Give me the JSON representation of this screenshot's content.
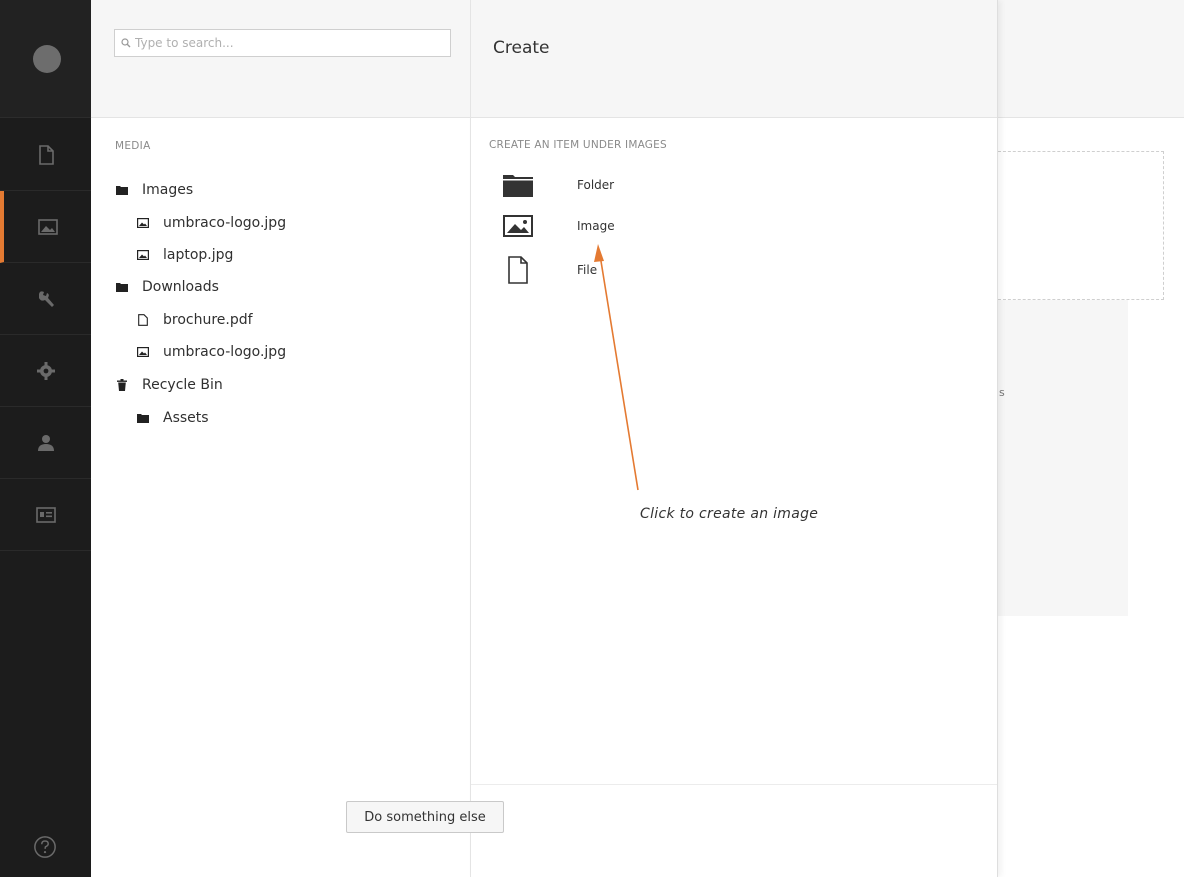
{
  "search": {
    "placeholder": "Type to search..."
  },
  "tree": {
    "section_title": "MEDIA",
    "nodes": [
      {
        "label": "Images",
        "icon": "folder-icon"
      },
      {
        "label": "umbraco-logo.jpg",
        "icon": "image-icon"
      },
      {
        "label": "laptop.jpg",
        "icon": "image-icon"
      },
      {
        "label": "Downloads",
        "icon": "folder-icon"
      },
      {
        "label": "brochure.pdf",
        "icon": "file-icon"
      },
      {
        "label": "umbraco-logo.jpg",
        "icon": "image-icon"
      },
      {
        "label": "Recycle Bin",
        "icon": "trash-icon"
      },
      {
        "label": "Assets",
        "icon": "folder-icon"
      }
    ]
  },
  "create": {
    "title": "Create",
    "subtitle": "CREATE AN ITEM UNDER IMAGES",
    "options": [
      {
        "label": "Folder",
        "icon": "folder-icon"
      },
      {
        "label": "Image",
        "icon": "image-icon"
      },
      {
        "label": "File",
        "icon": "file-icon"
      }
    ],
    "footer_button": "Do something else"
  },
  "background": {
    "fragment": "s"
  },
  "annotation": {
    "text": "Click to create an image",
    "color": "#e47a32"
  },
  "colors": {
    "accent": "#e47a32",
    "rail": "#1c1c1c"
  }
}
